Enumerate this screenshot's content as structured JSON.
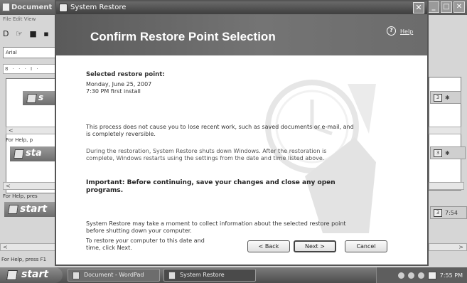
{
  "wordpad": {
    "title": "Document",
    "menu": "File  Edit  View",
    "toolbar": "D ☞ ■ ▪",
    "font": "Arial",
    "ruler": "8 · · · I ·",
    "nested": [
      {
        "start": "s",
        "help": "For Help, p"
      },
      {
        "start": "sta",
        "help": "For Help, pres"
      },
      {
        "start": "start",
        "help": "For Help, press F1"
      }
    ],
    "mini_time": "7:54"
  },
  "dialog": {
    "title": "System Restore",
    "close": "✕",
    "heading": "Confirm Restore Point Selection",
    "help_icon": "?",
    "help_link": "Help",
    "selected_label": "Selected restore point:",
    "selected_date": "Monday, June 25, 2007",
    "selected_desc": "7:30 PM first install",
    "note_reversible": "This process does not cause you to lose recent work, such as saved documents or e-mail, and is completely reversible.",
    "note_shutdown": "During the restoration, System Restore shuts down Windows. After the restoration is complete, Windows restarts using the settings from the date and time listed above.",
    "important": "Important: Before continuing, save your changes and close any open programs.",
    "collect_info": "System Restore may take a moment to collect information about the selected restore point before shutting down your computer.",
    "instruction": "To restore your computer to this date and time, click Next.",
    "buttons": {
      "back": "< Back",
      "next": "Next >",
      "cancel": "Cancel"
    }
  },
  "taskbar": {
    "start": "start",
    "tasks": [
      {
        "label": "Document - WordPad",
        "active": false
      },
      {
        "label": "System Restore",
        "active": true
      }
    ],
    "clock": "7:55 PM"
  }
}
